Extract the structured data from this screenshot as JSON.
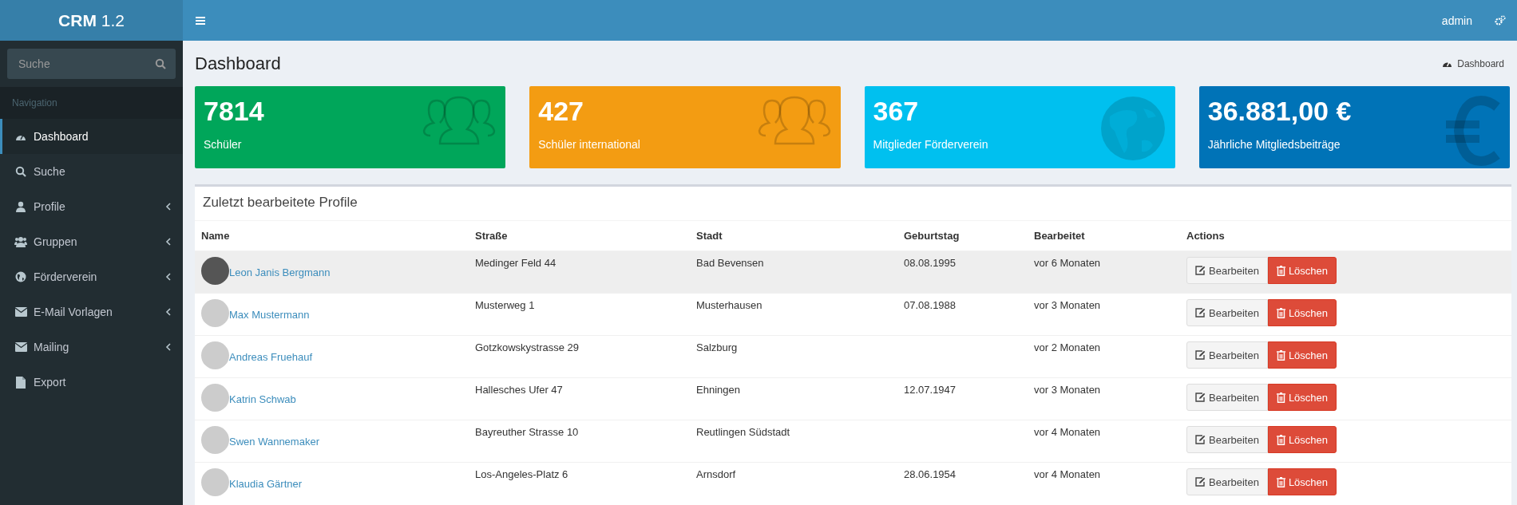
{
  "brand": {
    "bold": "CRM",
    "light": "1.2"
  },
  "topbar": {
    "user": "admin"
  },
  "sidebar": {
    "search": {
      "placeholder": "Suche"
    },
    "section": "Navigation",
    "items": [
      {
        "label": "Dashboard",
        "selected": true,
        "expandable": false
      },
      {
        "label": "Suche",
        "selected": false,
        "expandable": false
      },
      {
        "label": "Profile",
        "selected": false,
        "expandable": true
      },
      {
        "label": "Gruppen",
        "selected": false,
        "expandable": true
      },
      {
        "label": "Förderverein",
        "selected": false,
        "expandable": true
      },
      {
        "label": "E-Mail Vorlagen",
        "selected": false,
        "expandable": true
      },
      {
        "label": "Mailing",
        "selected": false,
        "expandable": true
      },
      {
        "label": "Export",
        "selected": false,
        "expandable": false
      }
    ]
  },
  "page": {
    "title": "Dashboard",
    "breadcrumb": "Dashboard"
  },
  "stats": [
    {
      "value": "7814",
      "label": "Schüler",
      "color": "#00a65a",
      "kind": "users"
    },
    {
      "value": "427",
      "label": "Schüler international",
      "color": "#f39c12",
      "kind": "users"
    },
    {
      "value": "367",
      "label": "Mitglieder Förderverein",
      "color": "#00c0ef",
      "kind": "globe"
    },
    {
      "value": "36.881,00 €",
      "label": "Jährliche Mitgliedsbeiträge",
      "color": "#0073b7",
      "kind": "euro"
    }
  ],
  "table": {
    "title": "Zuletzt bearbeitete Profile",
    "columns": [
      "Name",
      "Straße",
      "Stadt",
      "Geburtstag",
      "Bearbeitet",
      "Actions"
    ],
    "rows": [
      {
        "name": "Leon Janis Bergmann",
        "street": "Medinger Feld 44",
        "city": "Bad Bevensen",
        "birthday": "08.08.1995",
        "edited": "vor 6 Monaten",
        "has_photo": true,
        "selected": true,
        "edit": "Bearbeiten",
        "delete": "Löschen"
      },
      {
        "name": "Max Mustermann",
        "street": "Musterweg 1",
        "city": "Musterhausen",
        "birthday": "07.08.1988",
        "edited": "vor 3 Monaten",
        "has_photo": false,
        "selected": false,
        "edit": "Bearbeiten",
        "delete": "Löschen"
      },
      {
        "name": "Andreas Fruehauf",
        "street": "Gotzkowskystrasse 29",
        "city": "Salzburg",
        "edited": "vor 2 Monaten",
        "has_photo": false,
        "selected": false,
        "edit": "Bearbeiten",
        "delete": "Löschen"
      },
      {
        "name": "Katrin Schwab",
        "street": "Hallesches Ufer 47",
        "city": "Ehningen",
        "birthday": "12.07.1947",
        "edited": "vor 3 Monaten",
        "has_photo": false,
        "selected": false,
        "edit": "Bearbeiten",
        "delete": "Löschen"
      },
      {
        "name": "Swen Wannemaker",
        "street": "Bayreuther Strasse 10",
        "city": "Reutlingen Südstadt",
        "edited": "vor 4 Monaten",
        "has_photo": false,
        "selected": false,
        "edit": "Bearbeiten",
        "delete": "Löschen"
      },
      {
        "name": "Klaudia Gärtner",
        "street": "Los-Angeles-Platz 6",
        "city": "Arnsdorf",
        "birthday": "28.06.1954",
        "edited": "vor 4 Monaten",
        "has_photo": false,
        "selected": false,
        "edit": "Bearbeiten",
        "delete": "Löschen"
      }
    ]
  }
}
